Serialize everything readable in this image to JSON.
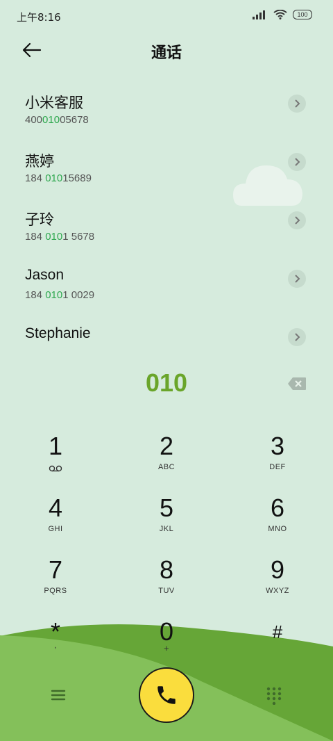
{
  "status": {
    "time": "上午8:16",
    "battery": "100"
  },
  "header": {
    "title": "通话"
  },
  "contacts": [
    {
      "name": "小米客服",
      "number_pre": "400",
      "number_hl": "010",
      "number_post": "05678"
    },
    {
      "name": "燕婷",
      "number_pre": "184 ",
      "number_hl": "010",
      "number_post": "15689"
    },
    {
      "name": "子玲",
      "number_pre": "184 ",
      "number_hl": "010",
      "number_post": "1 5678"
    },
    {
      "name": "Jason",
      "number_pre": "184 ",
      "number_hl": "010",
      "number_post": "1 0029"
    },
    {
      "name": "Stephanie",
      "number_pre": "",
      "number_hl": "",
      "number_post": ""
    }
  ],
  "dialer": {
    "entered": "010"
  },
  "keys": [
    {
      "digit": "1",
      "letters": ""
    },
    {
      "digit": "2",
      "letters": "ABC"
    },
    {
      "digit": "3",
      "letters": "DEF"
    },
    {
      "digit": "4",
      "letters": "GHI"
    },
    {
      "digit": "5",
      "letters": "JKL"
    },
    {
      "digit": "6",
      "letters": "MNO"
    },
    {
      "digit": "7",
      "letters": "PQRS"
    },
    {
      "digit": "8",
      "letters": "TUV"
    },
    {
      "digit": "9",
      "letters": "WXYZ"
    },
    {
      "digit": "*",
      "letters": ","
    },
    {
      "digit": "0",
      "letters": "+"
    },
    {
      "digit": "#",
      "letters": ""
    }
  ],
  "icons": {
    "back": "arrow-left-icon",
    "backspace": "backspace-icon",
    "voicemail": "voicemail-icon",
    "menu": "menu-icon",
    "call": "phone-icon",
    "dialpad": "dialpad-icon"
  },
  "colors": {
    "background": "#d6ebdd",
    "highlight": "#2fa84f",
    "dial_text": "#6aa52a",
    "call_button": "#fadd3d",
    "hill_dark": "#66a637",
    "hill_light": "#84c05a"
  }
}
